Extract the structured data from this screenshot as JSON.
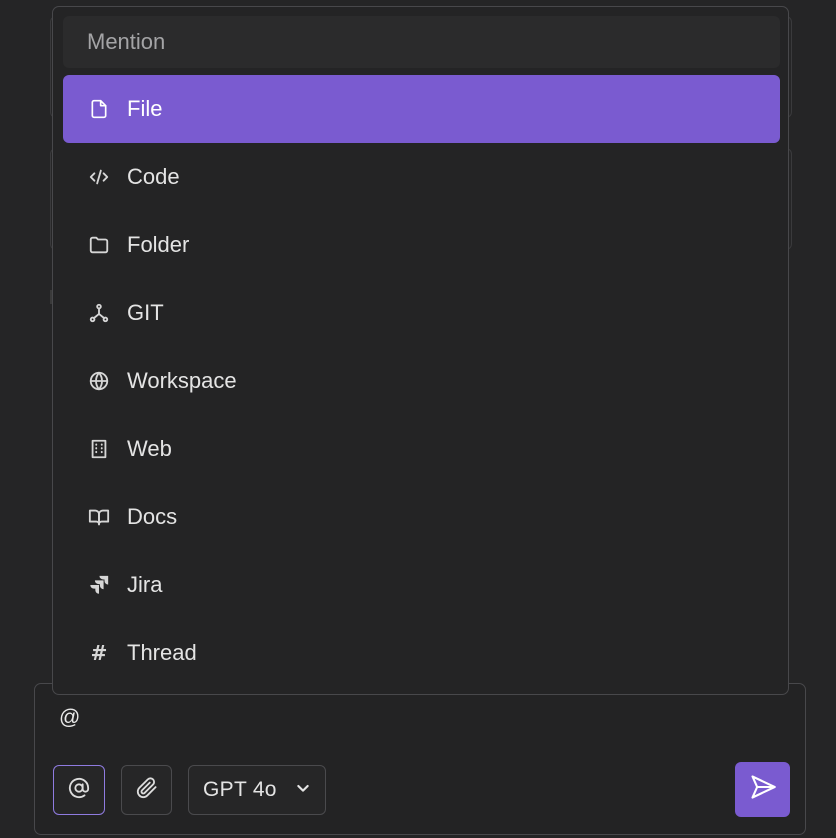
{
  "mention_menu": {
    "header": "Mention",
    "items": [
      {
        "label": "File",
        "icon": "file-icon",
        "selected": true
      },
      {
        "label": "Code",
        "icon": "code-icon",
        "selected": false
      },
      {
        "label": "Folder",
        "icon": "folder-icon",
        "selected": false
      },
      {
        "label": "GIT",
        "icon": "git-branch-icon",
        "selected": false
      },
      {
        "label": "Workspace",
        "icon": "globe-icon",
        "selected": false
      },
      {
        "label": "Web",
        "icon": "building-icon",
        "selected": false
      },
      {
        "label": "Docs",
        "icon": "book-icon",
        "selected": false
      },
      {
        "label": "Jira",
        "icon": "jira-icon",
        "selected": false
      },
      {
        "label": "Thread",
        "icon": "hash-icon",
        "selected": false
      }
    ]
  },
  "composer": {
    "input_value": "@",
    "model_select": {
      "value": "GPT 4o"
    },
    "buttons": {
      "mention": {
        "icon": "at-icon"
      },
      "attach": {
        "icon": "paperclip-icon"
      },
      "send": {
        "icon": "send-icon"
      }
    }
  },
  "colors": {
    "background": "#252526",
    "accent": "#7a5bd0",
    "border": "#48484b"
  }
}
